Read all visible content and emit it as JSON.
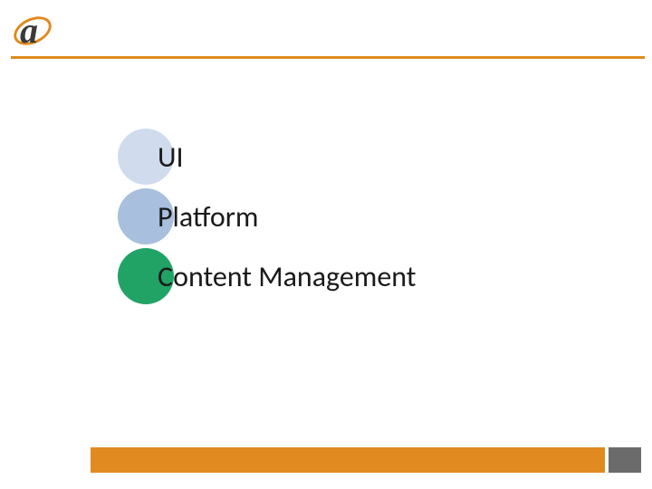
{
  "logo": {
    "letter": "a"
  },
  "items": [
    {
      "label": "UI"
    },
    {
      "label": "Platform"
    },
    {
      "label": "Content Management"
    }
  ],
  "colors": {
    "accent": "#e08a1f",
    "circle1": "#d0dcee",
    "circle2": "#a8bfdd",
    "circle3": "#21a366",
    "footer_accent": "#6b6b6b"
  }
}
